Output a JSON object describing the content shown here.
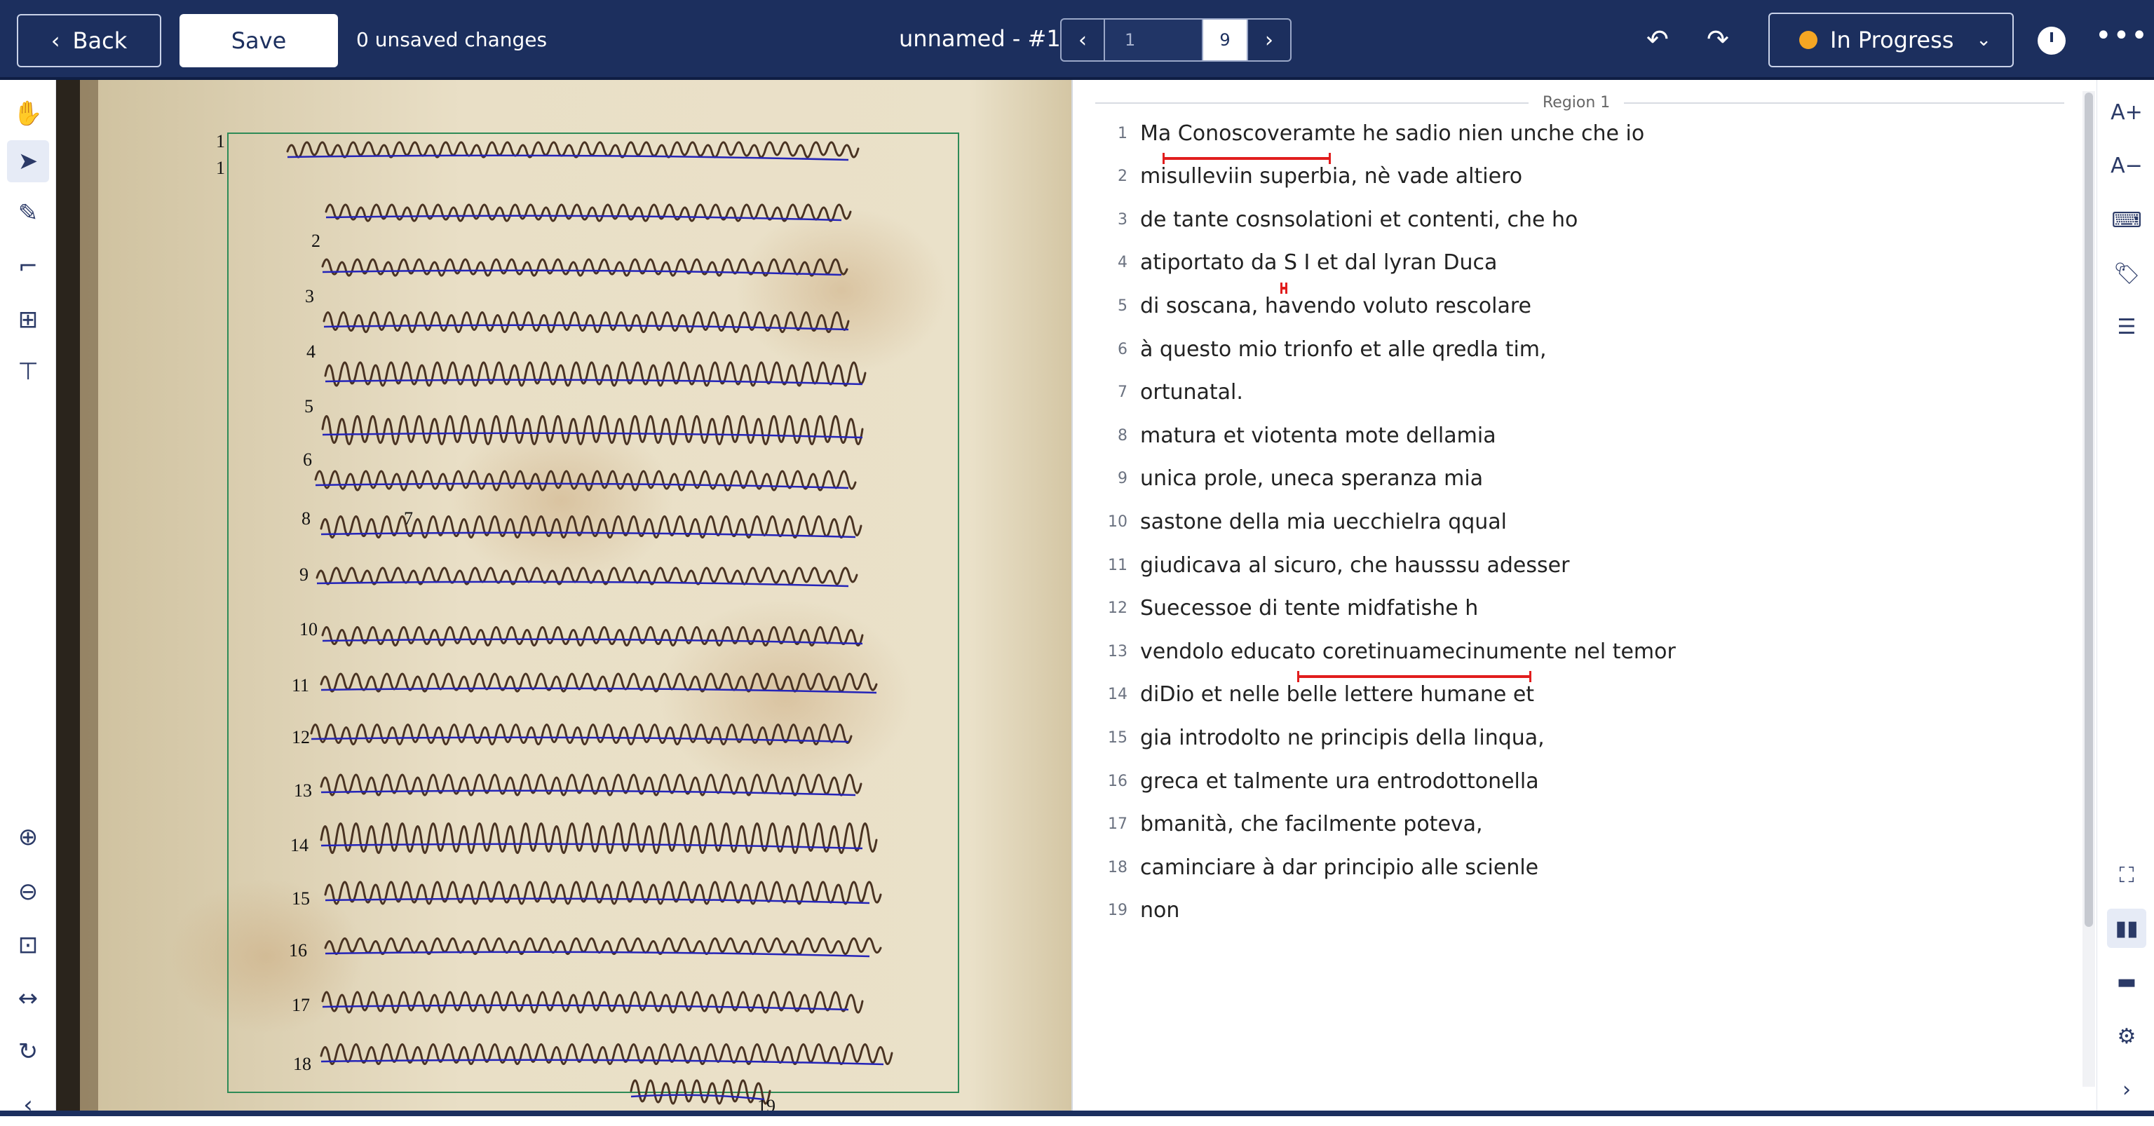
{
  "toolbar": {
    "back_label": "Back",
    "save_label": "Save",
    "unsaved_text": "0 unsaved changes",
    "title": "unnamed - #1",
    "page_current": "1",
    "page_total": "9",
    "status_label": "In Progress",
    "status_color": "#f5a623"
  },
  "left_tools": [
    "hand-icon",
    "select-arrow-icon",
    "pen-icon",
    "crop-icon",
    "split-region-icon",
    "baseline-icon",
    "zoom-in-icon",
    "zoom-out-icon",
    "fit-icon",
    "fit-width-icon",
    "rotate-icon",
    "collapse-left-icon"
  ],
  "right_tools": [
    "font-increase-icon",
    "font-decrease-icon",
    "keyboard-icon",
    "tag-icon",
    "list-icon",
    "fullscreen-icon",
    "split-vertical-icon",
    "split-horizontal-icon",
    "settings-icon",
    "collapse-right-icon"
  ],
  "region": {
    "label": "Region 1",
    "lines": [
      {
        "n": "1",
        "text": "Ma Conoscoveramte he sadio nien unche che io"
      },
      {
        "n": "2",
        "text": "misulleviin superbia, nè vade altiero"
      },
      {
        "n": "3",
        "text": "de tante cosnsolationi et contenti, che ho"
      },
      {
        "n": "4",
        "text": "atiportato da S I et dal lyran Duca"
      },
      {
        "n": "5",
        "text": "di soscana, havendo voluto rescolare"
      },
      {
        "n": "6",
        "text": "à questo mio trionfo et alle qredla tim,"
      },
      {
        "n": "7",
        "text": "ortunatal."
      },
      {
        "n": "8",
        "text": "matura et viotenta mote dellamia"
      },
      {
        "n": "9",
        "text": "unica prole, uneca speranza mia"
      },
      {
        "n": "10",
        "text": "sastone della mia uecchielra qqual"
      },
      {
        "n": "11",
        "text": "giudicava al sicuro, che hausssu adesser"
      },
      {
        "n": "12",
        "text": "Suecessoe di tente midfatishe h"
      },
      {
        "n": "13",
        "text": "vendolo educato coretinuamecinumente nel temor"
      },
      {
        "n": "14",
        "text": "diDio et nelle belle lettere humane et"
      },
      {
        "n": "15",
        "text": "gia introdolto ne principis della linqua,"
      },
      {
        "n": "16",
        "text": "greca et talmente ura entrodottonella"
      },
      {
        "n": "17",
        "text": "bmanità, che facilmente poteva,"
      },
      {
        "n": "18",
        "text": "caminciare à dar principio alle scienle"
      },
      {
        "n": "19",
        "text": "non"
      }
    ]
  },
  "image_line_numbers": [
    "1",
    "1",
    "2",
    "3",
    "4",
    "5",
    "6",
    "7",
    "8",
    "9",
    "10",
    "11",
    "12",
    "13",
    "14",
    "15",
    "16",
    "17",
    "18",
    "19"
  ]
}
